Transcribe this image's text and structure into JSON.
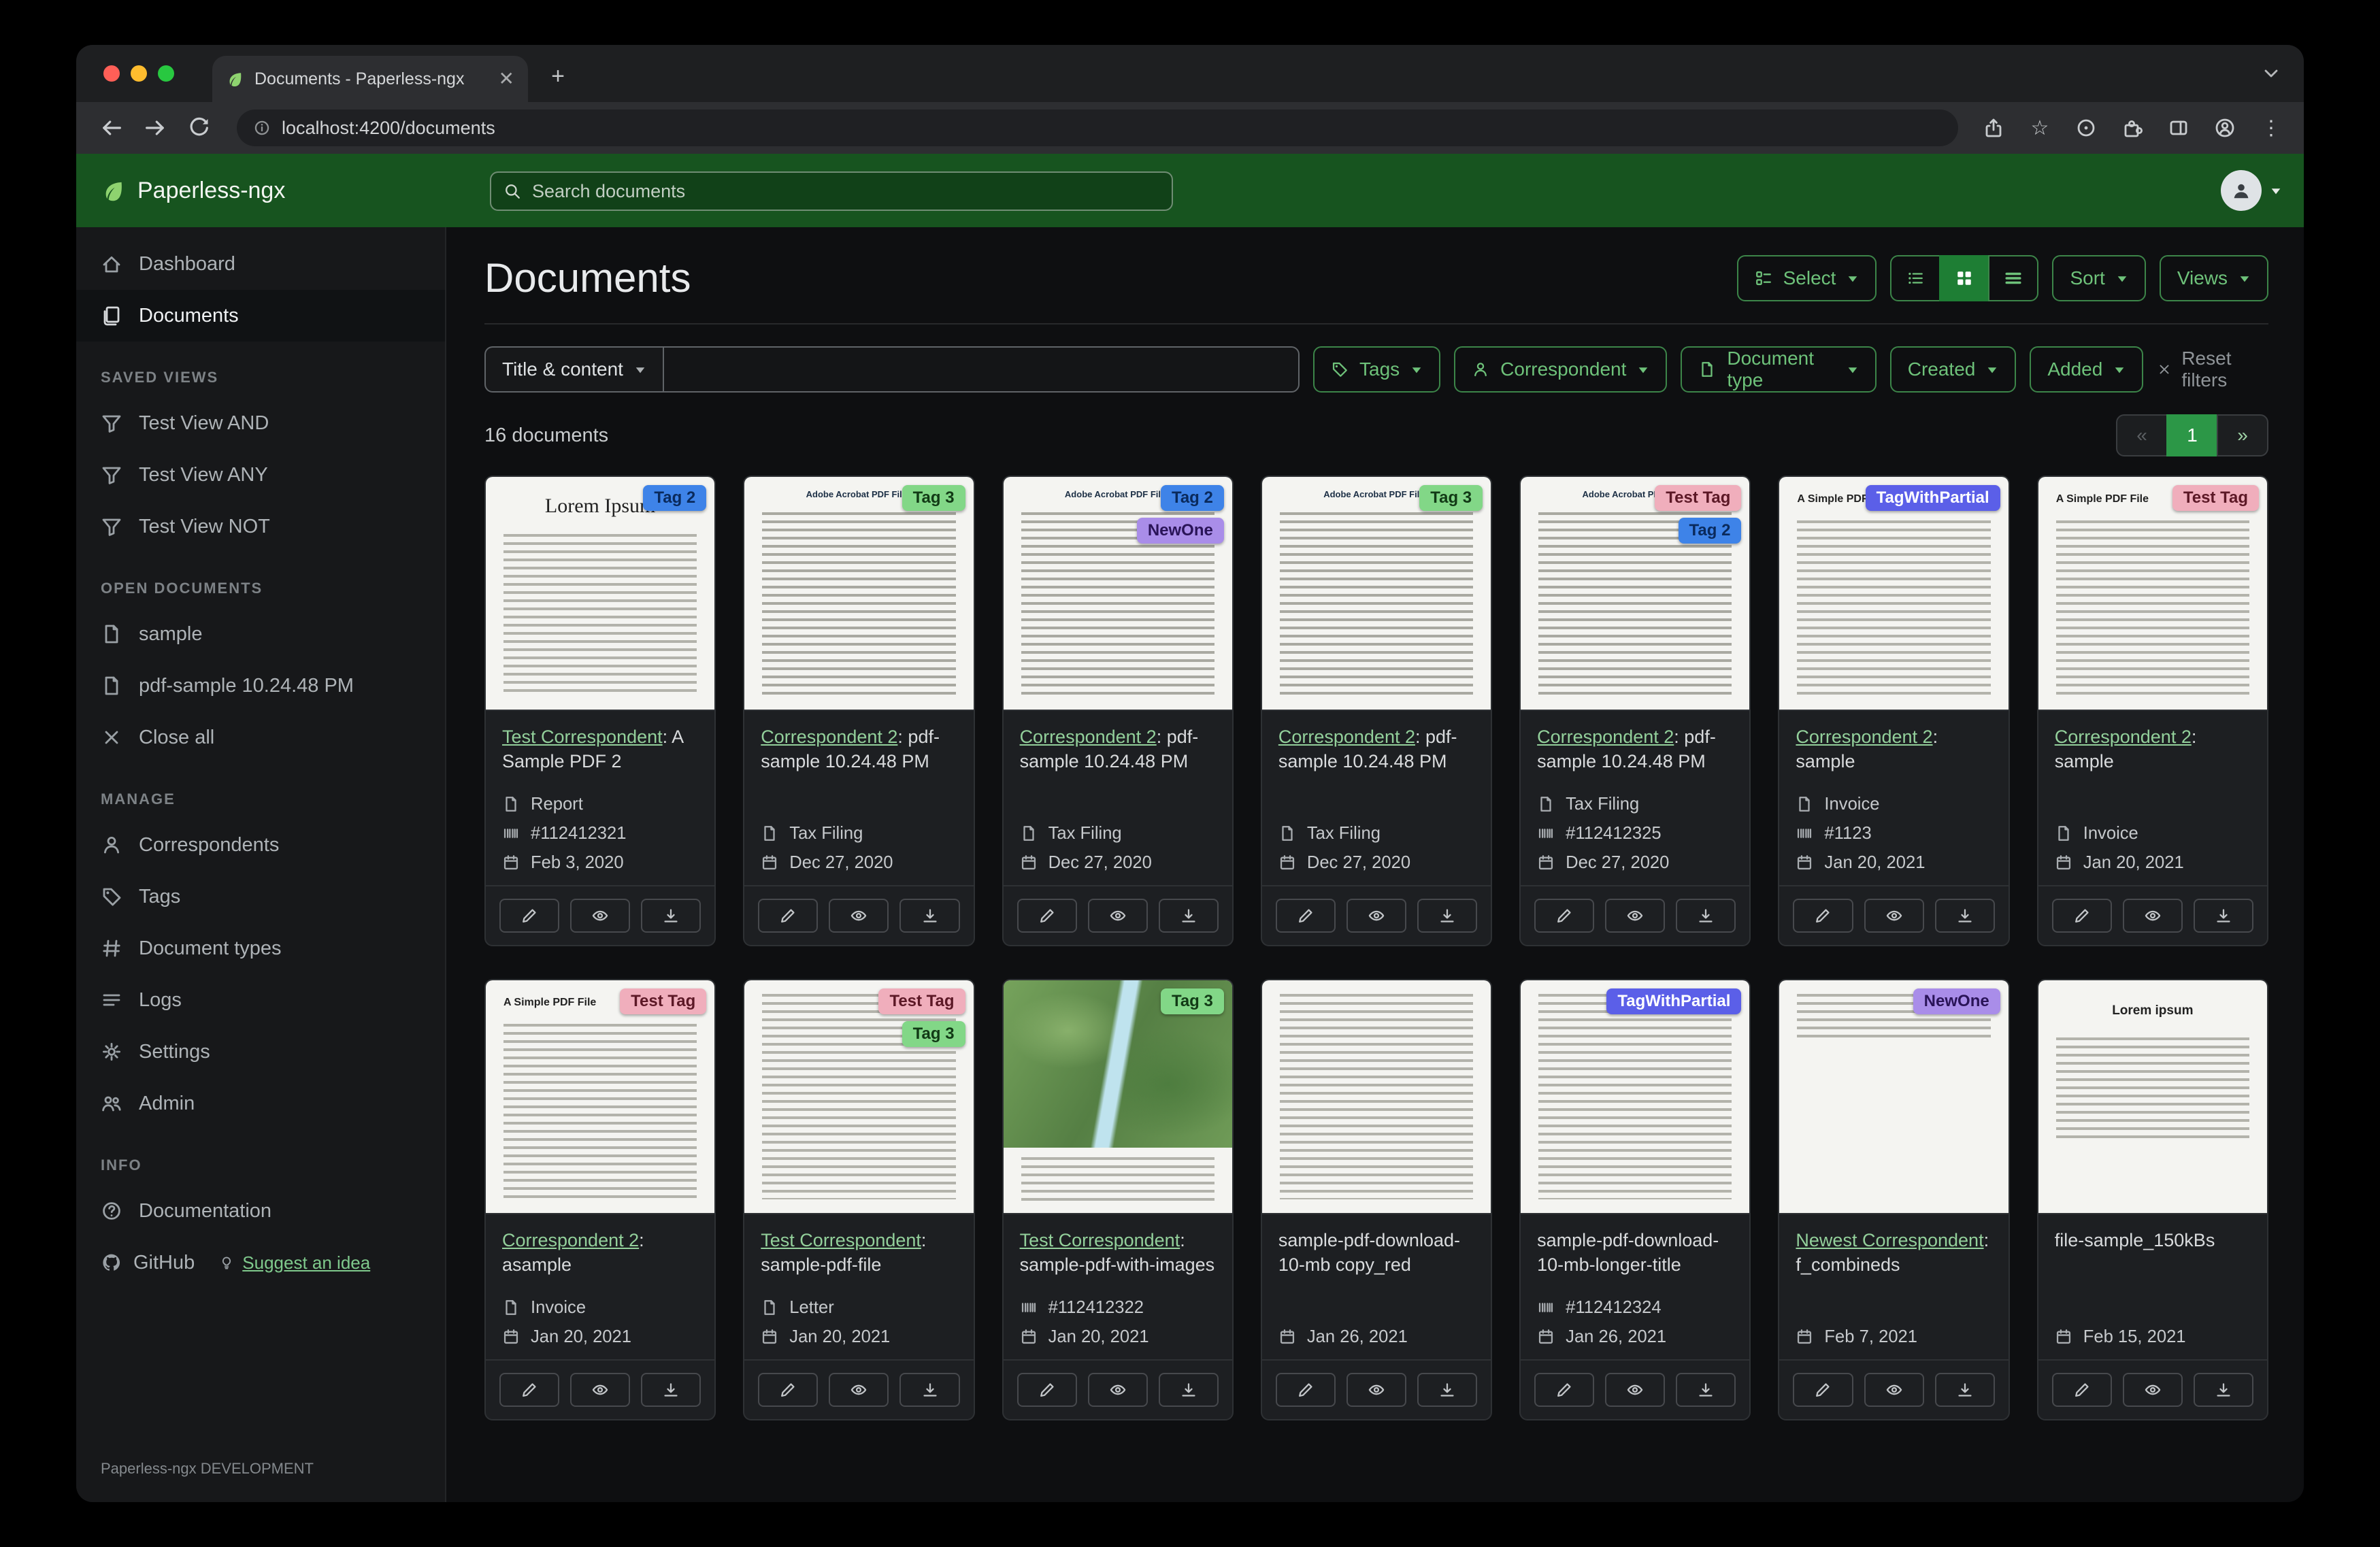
{
  "browser": {
    "tab_title": "Documents - Paperless-ngx",
    "url": "localhost:4200/documents"
  },
  "navbar": {
    "brand": "Paperless-ngx",
    "search_placeholder": "Search documents"
  },
  "sidebar": {
    "dashboard": "Dashboard",
    "documents": "Documents",
    "saved_views_title": "SAVED VIEWS",
    "saved_views": [
      "Test View AND",
      "Test View ANY",
      "Test View NOT"
    ],
    "open_documents_title": "OPEN DOCUMENTS",
    "open_documents": [
      "sample",
      "pdf-sample 10.24.48 PM"
    ],
    "close_all": "Close all",
    "manage_title": "MANAGE",
    "manage": [
      "Correspondents",
      "Tags",
      "Document types",
      "Logs",
      "Settings",
      "Admin"
    ],
    "info_title": "INFO",
    "documentation": "Documentation",
    "github": "GitHub",
    "suggest": "Suggest an idea",
    "footer": "Paperless-ngx DEVELOPMENT"
  },
  "page": {
    "title": "Documents",
    "select": "Select",
    "sort": "Sort",
    "views": "Views",
    "count": "16 documents"
  },
  "filters": {
    "field": "Title & content",
    "tags": "Tags",
    "correspondent": "Correspondent",
    "document_type": "Document type",
    "created": "Created",
    "added": "Added",
    "reset": "Reset filters"
  },
  "pagination": {
    "prev": "«",
    "current": "1",
    "next": "»"
  },
  "tag_colors": {
    "Tag 2": {
      "bg": "#3e83e8",
      "fg": "#0a2a5c"
    },
    "Tag 3": {
      "bg": "#82d787",
      "fg": "#123a16"
    },
    "NewOne": {
      "bg": "#a98de9",
      "fg": "#2a1458"
    },
    "Test Tag": {
      "bg": "#f0aebc",
      "fg": "#5c1826"
    },
    "TagWithPartial": {
      "bg": "#5b5fe8",
      "fg": "#ffffff"
    }
  },
  "cards": [
    {
      "tags": [
        "Tag 2"
      ],
      "title_link": "Test Correspondent",
      "title_rest": ": A Sample PDF 2",
      "doc_type": "Report",
      "asn": "#112412321",
      "date": "Feb 3, 2020",
      "thumb": {
        "kind": "article",
        "heading": "Lorem Ipsum"
      }
    },
    {
      "tags": [
        "Tag 3"
      ],
      "title_link": "Correspondent 2",
      "title_rest": ": pdf-sample 10.24.48 PM",
      "doc_type": "Tax Filing",
      "date": "Dec 27, 2020",
      "thumb": {
        "kind": "pdf",
        "heading": "Adobe Acrobat PDF Files"
      }
    },
    {
      "tags": [
        "Tag 2",
        "NewOne"
      ],
      "title_link": "Correspondent 2",
      "title_rest": ": pdf-sample 10.24.48 PM",
      "doc_type": "Tax Filing",
      "date": "Dec 27, 2020",
      "thumb": {
        "kind": "pdf",
        "heading": "Adobe Acrobat PDF Files"
      }
    },
    {
      "tags": [
        "Tag 3"
      ],
      "title_link": "Correspondent 2",
      "title_rest": ": pdf-sample 10.24.48 PM",
      "doc_type": "Tax Filing",
      "date": "Dec 27, 2020",
      "thumb": {
        "kind": "pdf",
        "heading": "Adobe Acrobat PDF Files"
      }
    },
    {
      "tags": [
        "Test Tag",
        "Tag 2"
      ],
      "title_link": "Correspondent 2",
      "title_rest": ": pdf-sample 10.24.48 PM",
      "doc_type": "Tax Filing",
      "asn": "#112412325",
      "date": "Dec 27, 2020",
      "thumb": {
        "kind": "pdf",
        "heading": "Adobe Acrobat PDF Files"
      }
    },
    {
      "tags": [
        "TagWithPartial"
      ],
      "title_link": "Correspondent 2",
      "title_rest": ": sample",
      "doc_type": "Invoice",
      "asn": "#1123",
      "date": "Jan 20, 2021",
      "thumb": {
        "kind": "simple",
        "heading": "A Simple PDF File"
      }
    },
    {
      "tags": [
        "Test Tag"
      ],
      "title_link": "Correspondent 2",
      "title_rest": ": sample",
      "doc_type": "Invoice",
      "date": "Jan 20, 2021",
      "thumb": {
        "kind": "simple",
        "heading": "A Simple PDF File"
      }
    },
    {
      "tags": [
        "Test Tag"
      ],
      "title_link": "Correspondent 2",
      "title_rest": ": asample",
      "doc_type": "Invoice",
      "date": "Jan 20, 2021",
      "thumb": {
        "kind": "simple",
        "heading": "A Simple PDF File"
      }
    },
    {
      "tags": [
        "Test Tag",
        "Tag 3"
      ],
      "title_link": "Test Correspondent",
      "title_rest": ": sample-pdf-file",
      "doc_type": "Letter",
      "date": "Jan 20, 2021",
      "thumb": {
        "kind": "dense"
      }
    },
    {
      "tags": [
        "Tag 3"
      ],
      "title_link": "Test Correspondent",
      "title_rest": ": sample-pdf-with-images",
      "asn": "#112412322",
      "date": "Jan 20, 2021",
      "thumb": {
        "kind": "map"
      }
    },
    {
      "tags": [],
      "title_rest": "sample-pdf-download-10-mb copy_red",
      "date": "Jan 26, 2021",
      "thumb": {
        "kind": "dense"
      }
    },
    {
      "tags": [
        "TagWithPartial"
      ],
      "title_rest": "sample-pdf-download-10-mb-longer-title",
      "asn": "#112412324",
      "date": "Jan 26, 2021",
      "thumb": {
        "kind": "dense"
      }
    },
    {
      "tags": [
        "NewOne"
      ],
      "title_link": "Newest Correspondent",
      "title_rest": ": f_combineds",
      "date": "Feb 7, 2021",
      "thumb": {
        "kind": "blank"
      }
    },
    {
      "tags": [],
      "title_rest": "file-sample_150kBs",
      "date": "Feb 15, 2021",
      "thumb": {
        "kind": "lorem",
        "heading": "Lorem ipsum"
      }
    }
  ]
}
